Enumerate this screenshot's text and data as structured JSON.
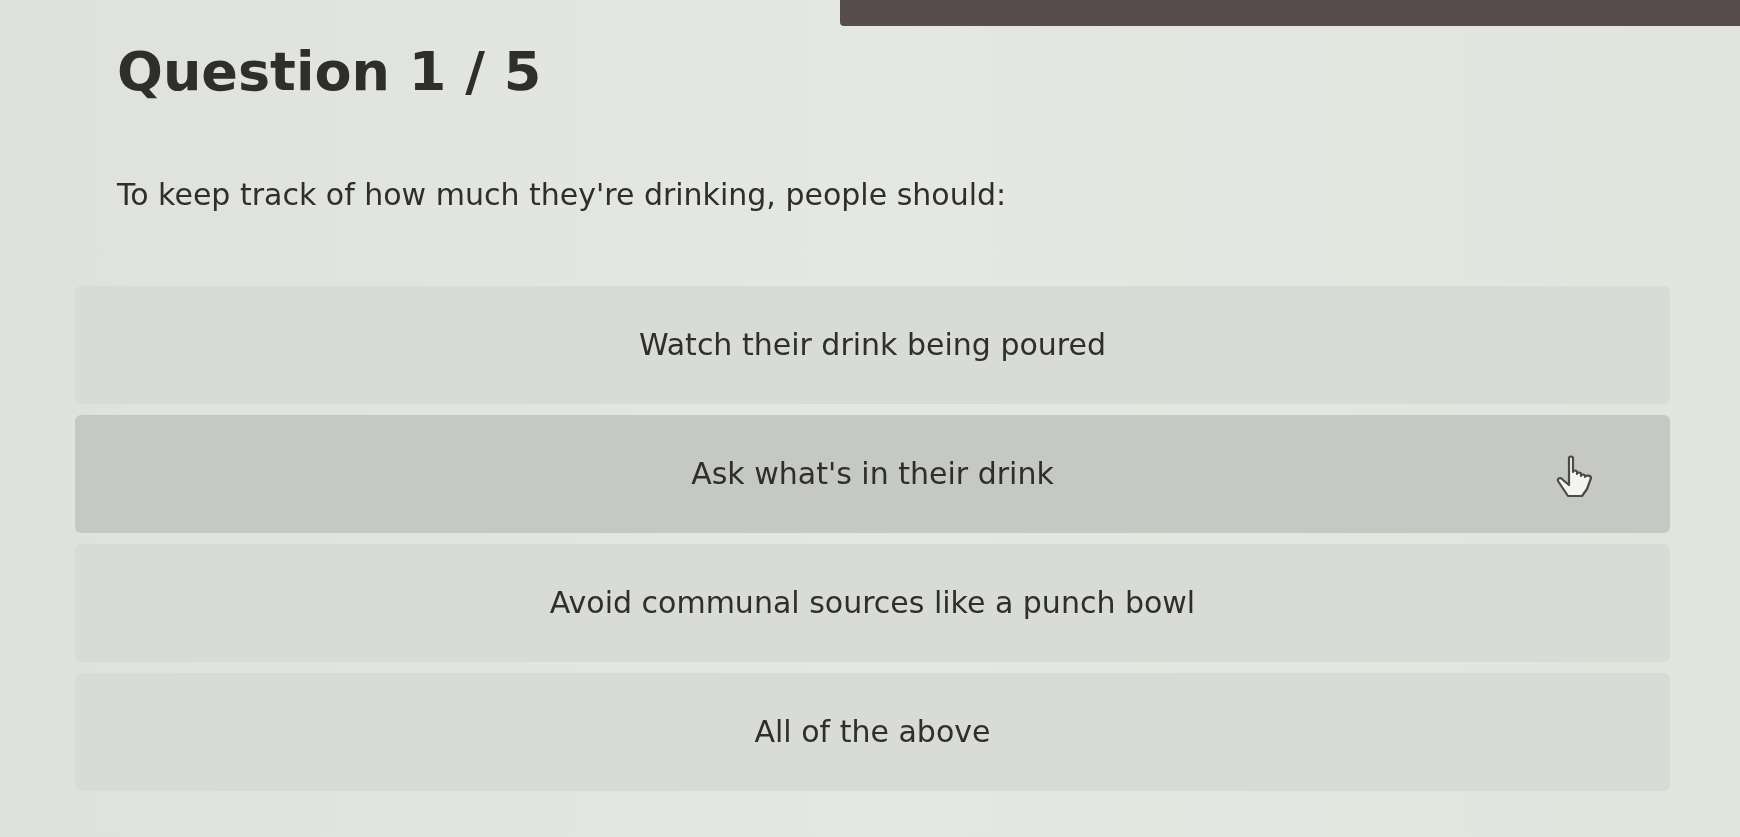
{
  "header": {
    "title": "Question 1 / 5"
  },
  "question": {
    "text": "To keep track of how much they're drinking, people should:"
  },
  "options": [
    {
      "label": "Watch their drink being poured",
      "hovered": false
    },
    {
      "label": "Ask what's in their drink",
      "hovered": true
    },
    {
      "label": "Avoid communal sources like a punch bowl",
      "hovered": false
    },
    {
      "label": "All of the above",
      "hovered": false
    }
  ]
}
